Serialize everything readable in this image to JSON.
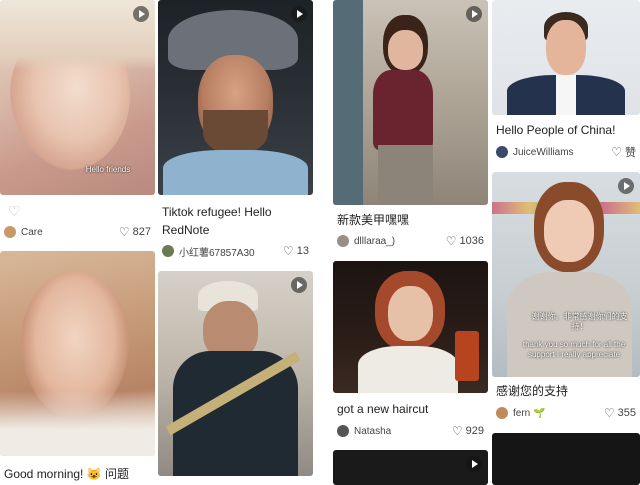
{
  "posts": [
    {
      "title": "",
      "user": "Care",
      "likes": "827",
      "avatar_color": "#c89a6a"
    },
    {
      "title": "Tiktok refugee! Hello RedNote",
      "user": "小红薯67857A30",
      "likes": "13",
      "avatar_color": "#6a7a52"
    },
    {
      "title": "新款美甲嘿嘿",
      "user": "dlllaraa_)",
      "likes": "1036",
      "avatar_color": "#9a8f88"
    },
    {
      "title": "Hello People of China!",
      "user": "JuiceWilliams",
      "likes": "赞",
      "avatar_color": "#3a4a6a"
    },
    {
      "title": "Good morning! 😺 问题",
      "user": "",
      "likes": ""
    },
    {
      "title": "",
      "user": "",
      "likes": ""
    },
    {
      "title": "got a new haircut",
      "user": "Natasha",
      "likes": "929",
      "avatar_color": "#555555"
    },
    {
      "title": "感谢您的支持",
      "user": "fern 🌱",
      "likes": "355",
      "avatar_color": "#c08a5a"
    }
  ],
  "overlays": {
    "post1_caption": "Hello friends",
    "post8_caption_cn": "谢谢你。非常感谢你们的支持！",
    "post8_caption_en": "thank you so much for all the support I really appreciate"
  },
  "icons": {
    "heart": "heart-icon",
    "play": "play-icon"
  }
}
